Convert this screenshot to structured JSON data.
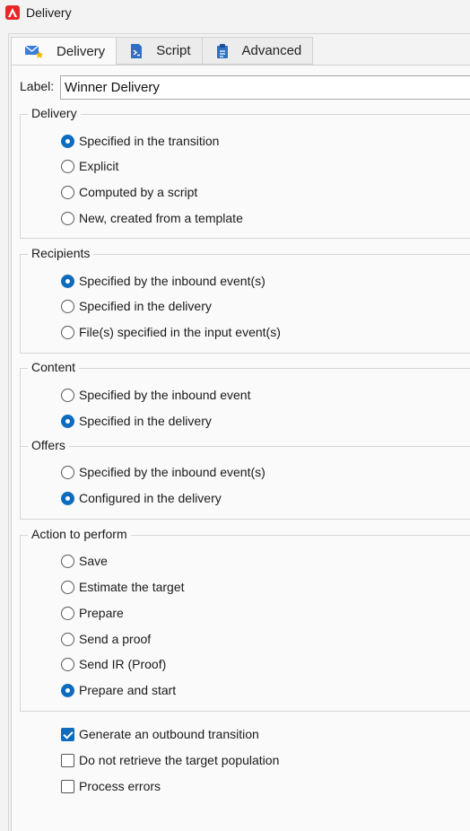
{
  "window": {
    "title": "Delivery",
    "app_icon": "adobe-campaign-icon",
    "accent": "#e8272a"
  },
  "tabs": [
    {
      "label": "Delivery",
      "icon": "envelope-star-icon",
      "active": true
    },
    {
      "label": "Script",
      "icon": "script-document-icon",
      "active": false
    },
    {
      "label": "Advanced",
      "icon": "clipboard-icon",
      "active": false
    }
  ],
  "label_field": {
    "label": "Label:",
    "value": "Winner Delivery"
  },
  "groups": {
    "delivery": {
      "title": "Delivery",
      "options": [
        {
          "label": "Specified in the transition",
          "selected": true
        },
        {
          "label": "Explicit",
          "selected": false
        },
        {
          "label": "Computed by a script",
          "selected": false
        },
        {
          "label": "New, created from a template",
          "selected": false
        }
      ]
    },
    "recipients": {
      "title": "Recipients",
      "options": [
        {
          "label": "Specified by the inbound event(s)",
          "selected": true
        },
        {
          "label": "Specified in the delivery",
          "selected": false
        },
        {
          "label": "File(s) specified in the input event(s)",
          "selected": false
        }
      ]
    },
    "content": {
      "title": "Content",
      "options": [
        {
          "label": "Specified by the inbound event",
          "selected": false
        },
        {
          "label": "Specified in the delivery",
          "selected": true
        }
      ],
      "offers_title": "Offers",
      "offers_options": [
        {
          "label": "Specified by the inbound event(s)",
          "selected": false
        },
        {
          "label": "Configured in the delivery",
          "selected": true
        }
      ]
    },
    "action": {
      "title": "Action to perform",
      "options": [
        {
          "label": "Save",
          "selected": false
        },
        {
          "label": "Estimate the target",
          "selected": false
        },
        {
          "label": "Prepare",
          "selected": false
        },
        {
          "label": "Send a proof",
          "selected": false
        },
        {
          "label": "Send IR (Proof)",
          "selected": false
        },
        {
          "label": "Prepare and start",
          "selected": true
        }
      ]
    }
  },
  "checkboxes": [
    {
      "label": "Generate an outbound transition",
      "checked": true
    },
    {
      "label": "Do not retrieve the target population",
      "checked": false
    },
    {
      "label": "Process errors",
      "checked": false
    }
  ],
  "colors": {
    "selection_blue": "#0f6cbd"
  }
}
